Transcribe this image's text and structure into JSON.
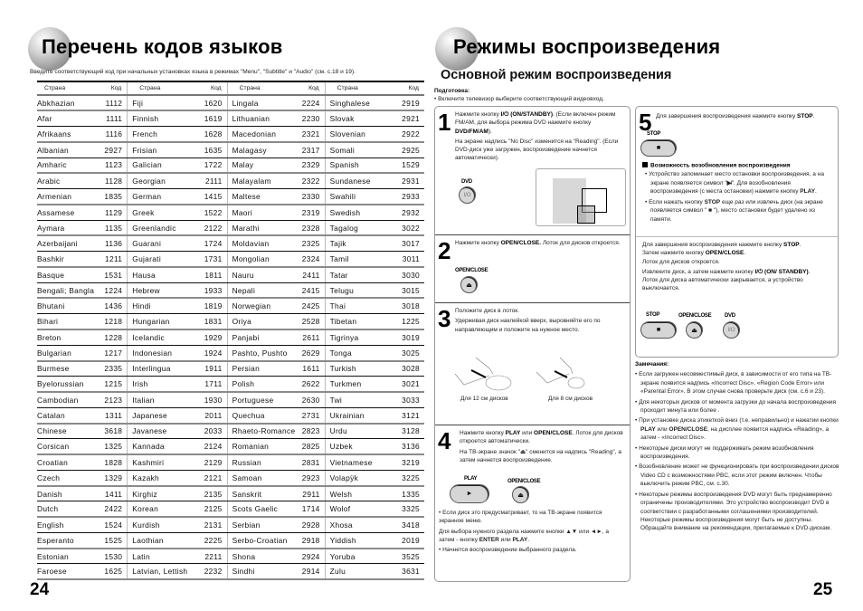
{
  "left_page": {
    "title": "Перечень кодов языков",
    "intro": "Введите соответствующий код при начальных установках языка в режимах \"Menu\", \"Subtitle\" и \"Audio\" (см. с.18 и 19).",
    "table": {
      "headers": [
        "Страна",
        "Код",
        "Страна",
        "Код",
        "Страна",
        "Код",
        "Страна",
        "Код"
      ],
      "rows": [
        [
          "Abkhazian",
          "1112",
          "Fiji",
          "1620",
          "Lingala",
          "2224",
          "Singhalese",
          "2919"
        ],
        [
          "Afar",
          "1111",
          "Finnish",
          "1619",
          "Lithuanian",
          "2230",
          "Slovak",
          "2921"
        ],
        [
          "Afrikaans",
          "1116",
          "French",
          "1628",
          "Macedonian",
          "2321",
          "Slovenian",
          "2922"
        ],
        [
          "Albanian",
          "2927",
          "Frisian",
          "1635",
          "Malagasy",
          "2317",
          "Somali",
          "2925"
        ],
        [
          "Amharic",
          "1123",
          "Galician",
          "1722",
          "Malay",
          "2329",
          "Spanish",
          "1529"
        ],
        [
          "Arabic",
          "1128",
          "Georgian",
          "2111",
          "Malayalam",
          "2322",
          "Sundanese",
          "2931"
        ],
        [
          "Armenian",
          "1835",
          "German",
          "1415",
          "Maltese",
          "2330",
          "Swahili",
          "2933"
        ],
        [
          "Assamese",
          "1129",
          "Greek",
          "1522",
          "Maori",
          "2319",
          "Swedish",
          "2932"
        ],
        [
          "Aymara",
          "1135",
          "Greenlandic",
          "2122",
          "Marathi",
          "2328",
          "Tagalog",
          "3022"
        ],
        [
          "Azerbaijani",
          "1136",
          "Guarani",
          "1724",
          "Moldavian",
          "2325",
          "Tajik",
          "3017"
        ],
        [
          "Bashkir",
          "1211",
          "Gujarati",
          "1731",
          "Mongolian",
          "2324",
          "Tamil",
          "3011"
        ],
        [
          "Basque",
          "1531",
          "Hausa",
          "1811",
          "Nauru",
          "2411",
          "Tatar",
          "3030"
        ],
        [
          "Bengali; Bangla",
          "1224",
          "Hebrew",
          "1933",
          "Nepali",
          "2415",
          "Telugu",
          "3015"
        ],
        [
          "Bhutani",
          "1436",
          "Hindi",
          "1819",
          "Norwegian",
          "2425",
          "Thai",
          "3018"
        ],
        [
          "Bihari",
          "1218",
          "Hungarian",
          "1831",
          "Oriya",
          "2528",
          "Tibetan",
          "1225"
        ],
        [
          "Breton",
          "1228",
          "Icelandic",
          "1929",
          "Panjabi",
          "2611",
          "Tigrinya",
          "3019"
        ],
        [
          "Bulgarian",
          "1217",
          "Indonesian",
          "1924",
          "Pashto, Pushto",
          "2629",
          "Tonga",
          "3025"
        ],
        [
          "Burmese",
          "2335",
          "Interlingua",
          "1911",
          "Persian",
          "1611",
          "Turkish",
          "3028"
        ],
        [
          "Byelorussian",
          "1215",
          "Irish",
          "1711",
          "Polish",
          "2622",
          "Turkmen",
          "3021"
        ],
        [
          "Cambodian",
          "2123",
          "Italian",
          "1930",
          "Portuguese",
          "2630",
          "Twi",
          "3033"
        ],
        [
          "Catalan",
          "1311",
          "Japanese",
          "2011",
          "Quechua",
          "2731",
          "Ukrainian",
          "3121"
        ],
        [
          "Chinese",
          "3618",
          "Javanese",
          "2033",
          "Rhaeto-Romance",
          "2823",
          "Urdu",
          "3128"
        ],
        [
          "Corsican",
          "1325",
          "Kannada",
          "2124",
          "Romanian",
          "2825",
          "Uzbek",
          "3136"
        ],
        [
          "Croatian",
          "1828",
          "Kashmiri",
          "2129",
          "Russian",
          "2831",
          "Vietnamese",
          "3219"
        ],
        [
          "Czech",
          "1329",
          "Kazakh",
          "2121",
          "Samoan",
          "2923",
          "Volapÿk",
          "3225"
        ],
        [
          "Danish",
          "1411",
          "Kirghiz",
          "2135",
          "Sanskrit",
          "2911",
          "Welsh",
          "1335"
        ],
        [
          "Dutch",
          "2422",
          "Korean",
          "2125",
          "Scots Gaelic",
          "1714",
          "Wolof",
          "3325"
        ],
        [
          "English",
          "1524",
          "Kurdish",
          "2131",
          "Serbian",
          "2928",
          "Xhosa",
          "3418"
        ],
        [
          "Esperanto",
          "1525",
          "Laothian",
          "2225",
          "Serbo-Croatian",
          "2918",
          "Yiddish",
          "2019"
        ],
        [
          "Estonian",
          "1530",
          "Latin",
          "2211",
          "Shona",
          "2924",
          "Yoruba",
          "3525"
        ],
        [
          "Faroese",
          "1625",
          "Latvian, Lettish",
          "2232",
          "Sindhi",
          "2914",
          "Zulu",
          "3631"
        ]
      ]
    },
    "page_number": "24"
  },
  "right_page": {
    "title": "Режимы воспроизведения",
    "subtitle": "Основной режим воспроизведения",
    "prep_label": "Подготовка:",
    "prep_text": "• Включите телевизор выберите соответствующий видеовход.",
    "steps": [
      {
        "number": "1",
        "html_lines": [
          "Нажмите кнопку <b>I/⏻</b> <b>(ON/STANDBY)</b>. (Если включен режим FM/AM, для выбора режима DVD нажмите кнопку <b>DVD/FM/AM</b>).",
          "На экране надпись \"No Disc\" изменится на \"Reading\". (Если DVD-диск уже загружен, воспроизведение начнется автоматически)."
        ],
        "button_label": "DVD",
        "button_glyph": "I/O"
      },
      {
        "number": "2",
        "html_lines": [
          "Нажмите кнопку <b>OPEN/CLOSE.</b> Лоток для дисков откроется."
        ],
        "button_label": "OPEN/CLOSE",
        "button_glyph": "⏏"
      },
      {
        "number": "3",
        "html_lines": [
          "Положите диск в лоток.",
          "Удерживая диск наклейкой вверх, выровняйте его по направляющим и положите на нужное место."
        ],
        "caption_12": "Для 12 см дисков",
        "caption_8": "Для 8 см дисков"
      },
      {
        "number": "4",
        "html_lines": [
          "Нажмите кнопку <b>PLAY</b> или <b>OPEN/CLOSE</b>. Лоток для дисков откроется автоматически.",
          "На ТВ-экране значок \"⏏\" сменится на надпись \"Reading\", а затем начнется воспроизведение."
        ],
        "play_label": "PLAY",
        "play_glyph": "►",
        "open_label": "OPEN/CLOSE",
        "open_glyph": "⏏",
        "after_lines": [
          "• Если диск это предусматривает, то на ТВ-экране появится экранное меню.",
          "Для выбора нужного раздела нажмите кнопки ▲▼ или ◄►, а затем - кнопку <b>ENTER</b> или <b>PLAY</b>.",
          "• Начнется воспроизведение выбранного раздела."
        ]
      },
      {
        "number": "5",
        "html_lines": [
          "Для завершения воспроизведения нажмите кнопку <b>STOP</b>."
        ],
        "stop_label": "STOP",
        "stop_glyph": "■",
        "resume_title": "Возможность возобновления воспроизведения",
        "resume_items": [
          "• Устройство запоминает место остановки воспроизведения, а на экране появляется символ \"<b>▶︎̸</b>\". Для возобновления воспроизведения (с места остановки) нажмите кнопку <b>PLAY</b>.",
          "• Если нажать кнопку <b>STOP</b> еще раз или извлечь диск (на экране появляется символ \" <b>■</b> \"), место остановки будет удалено из памяти."
        ]
      },
      {
        "html_lines": [
          "Для завершения воспроизведения нажмите кнопку <b>STOP</b>.<br>Затем нажмите кнопку <b>OPEN/CLOSE</b>.<br>Лоток для дисков откроется.",
          "Извлеките диск, а затем нажмите кнопку <b>I/⏻ (ON/ STANDBY)</b>.<br>Лоток для диска автоматически закрывается, а устройство выключается."
        ],
        "stop_label": "STOP",
        "open_label": "OPEN/CLOSE",
        "dvd_label": "DVD"
      }
    ],
    "notes": {
      "title": "Замечания:",
      "items": [
        "• Если загружен несовместимый диск, в зависимости от его типа на ТВ-экране появится надпись «Incorrect Disc», «Region Code Error» или «Parental Error». В этом случае снова проверьте диск (см. с.6 и 23).",
        "• Для некоторых дисков от момента загрузки до начала воспроизведения проходит минута или более .",
        "• При установке диска этикеткой вниз (т.е. неправильно) и нажатии кнопки <b>PLAY</b> или <b>OPEN/CLOSE</b>, на дисплее появится надпись «Reading», а затем - «Incorrect Disc».",
        "• Некоторые диски могут не поддерживать режим возобновления воспроизведения.",
        "• Возобновление может не функционировать при воспроизведении дисков Video CD с возможностями PBC, если этот режим включен. Чтобы выключить режим PBC, см. с.30.",
        "• Некоторые режимы воспроизведения DVD могут быть преднамеренно ограничены производителями. Это устройство воспроизводит DVD в соответствии с разработанными соглашениями производителей. Некоторые режимы воспроизведения могут быть не доступны. Обращайте внимание на рекомендации, прилагаемые к DVD-дискам."
      ]
    },
    "page_number": "25"
  }
}
